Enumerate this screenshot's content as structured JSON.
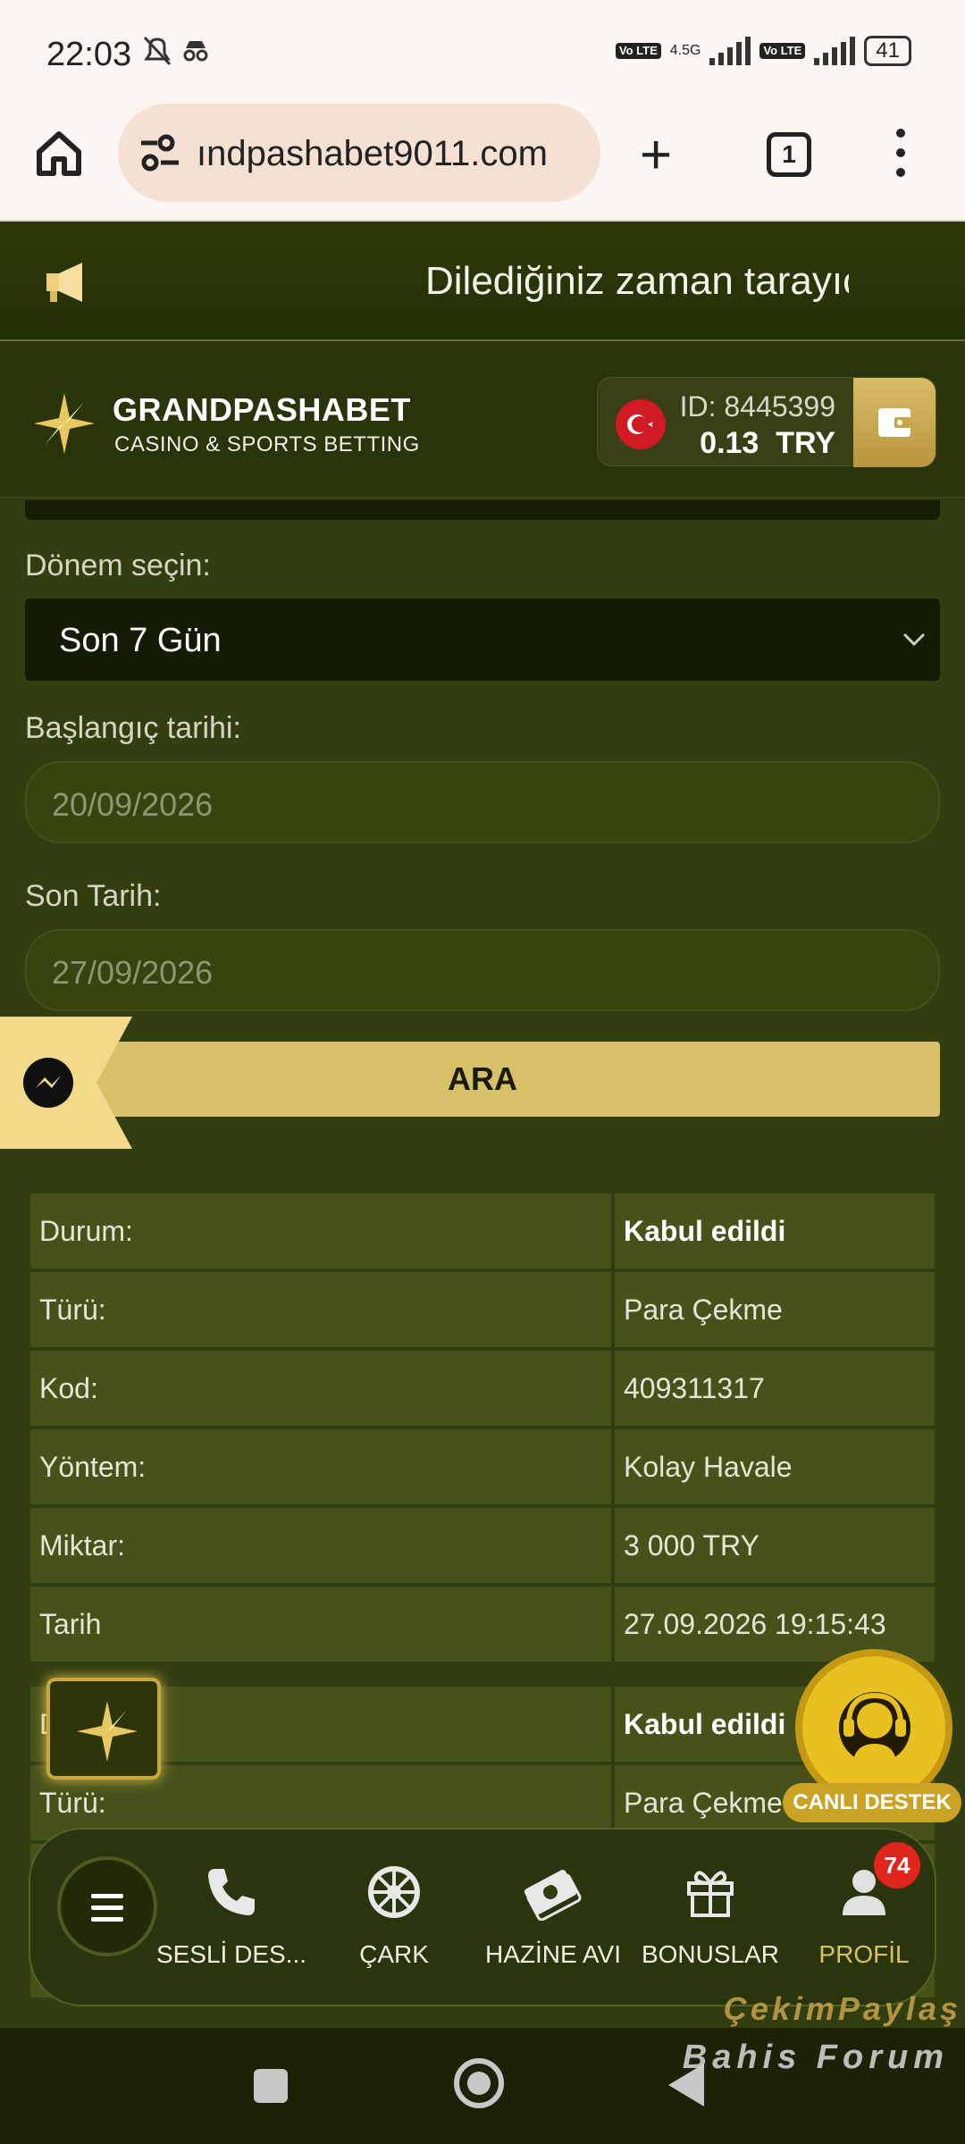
{
  "status_bar": {
    "time": "22:03",
    "network": "4.5G",
    "volte_label": "Vo LTE",
    "battery": "41"
  },
  "browser": {
    "url": "ındpashabet9011.com",
    "new_tab_label": "+",
    "tab_count": "1"
  },
  "announcement": {
    "text": "Dilediğiniz zaman tarayıc"
  },
  "header": {
    "brand": "GRANDPASHABET",
    "tagline": "CASINO & SPORTS BETTING",
    "account_id": "ID: 8445399",
    "balance": "0.13",
    "currency": "TRY"
  },
  "filters": {
    "period_label": "Dönem seçin:",
    "period_value": "Son 7 Gün",
    "start_label": "Başlangıç tarihi:",
    "start_value": "20/09/2026",
    "end_label": "Son Tarih:",
    "end_value": "27/09/2026",
    "search_button": "ARA"
  },
  "transactions": [
    {
      "rows": [
        {
          "key": "Durum:",
          "value": "Kabul edildi"
        },
        {
          "key": "Türü:",
          "value": "Para Çekme"
        },
        {
          "key": "Kod:",
          "value": "409311317"
        },
        {
          "key": "Yöntem:",
          "value": "Kolay Havale"
        },
        {
          "key": "Miktar:",
          "value": "3 000 TRY"
        },
        {
          "key": "Tarih",
          "value": "27.09.2026 19:15:43"
        }
      ]
    },
    {
      "rows": [
        {
          "key": "D",
          "value": "Kabul edildi"
        },
        {
          "key": "Türü:",
          "value": "Para Çekme"
        }
      ]
    }
  ],
  "support": {
    "label": "CANLI DESTEK"
  },
  "bottom_nav": {
    "items": [
      {
        "label": "SESLİ DES...",
        "icon": "phone-icon"
      },
      {
        "label": "ÇARK",
        "icon": "wheel-icon"
      },
      {
        "label": "HAZİNE AVI",
        "icon": "money-icon"
      },
      {
        "label": "BONUSLAR",
        "icon": "gift-icon"
      },
      {
        "label": "PROFİL",
        "icon": "user-icon",
        "badge": "74"
      }
    ]
  },
  "watermark": {
    "line1": "ÇekimPaylaş",
    "line2": "Bahis Forum"
  },
  "colors": {
    "accent_gold": "#d8c068",
    "page_bg": "#323e10",
    "badge_red": "#e0241e"
  }
}
